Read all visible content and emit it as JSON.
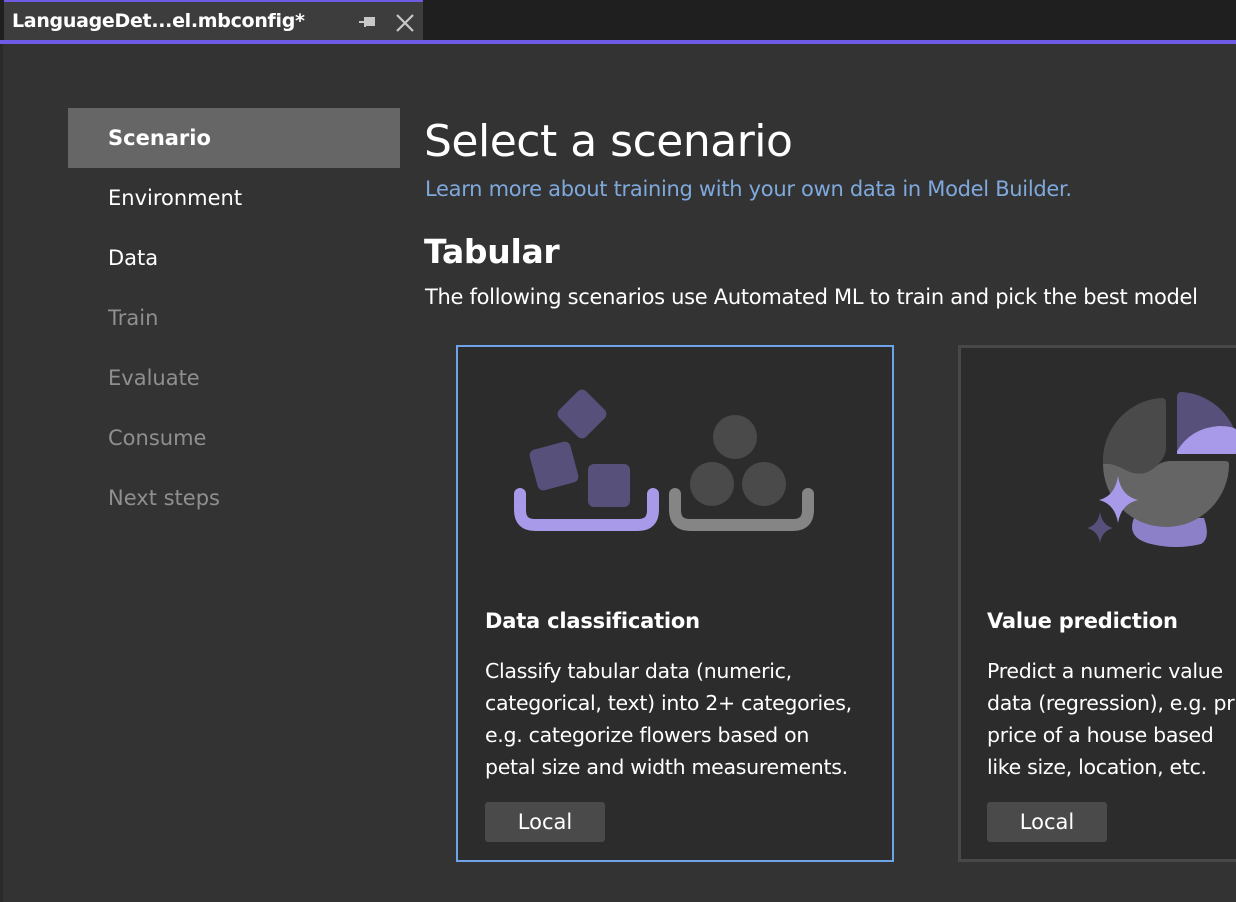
{
  "tab": {
    "title": "LanguageDet...el.mbconfig*",
    "pin_icon": "pin-icon",
    "close_icon": "close-icon"
  },
  "colors": {
    "accent": "#6e5ce6",
    "link": "#7fa9dd",
    "selected_card_border": "#6fa3e8",
    "nav_selected_bg": "#666666",
    "illustration_purple_light": "#a89ae8",
    "illustration_purple_dark": "#57507a",
    "illustration_gray": "#4a4a4a"
  },
  "nav": {
    "items": [
      {
        "label": "Scenario",
        "state": "selected"
      },
      {
        "label": "Environment",
        "state": "enabled"
      },
      {
        "label": "Data",
        "state": "enabled"
      },
      {
        "label": "Train",
        "state": "disabled"
      },
      {
        "label": "Evaluate",
        "state": "disabled"
      },
      {
        "label": "Consume",
        "state": "disabled"
      },
      {
        "label": "Next steps",
        "state": "disabled"
      }
    ]
  },
  "main": {
    "title": "Select a scenario",
    "learn_link": "Learn more about training with your own data in Model Builder.",
    "section": {
      "title": "Tabular",
      "description": "The following scenarios use Automated ML to train and pick the best model"
    },
    "cards": [
      {
        "title": "Data classification",
        "description_lines": [
          "Classify tabular data (numeric,",
          "categorical, text) into 2+ categories,",
          "e.g. categorize flowers based on",
          "petal size and width measurements."
        ],
        "button": "Local",
        "selected": true,
        "icon": "classification-illustration-icon"
      },
      {
        "title": "Value prediction",
        "description_lines": [
          "Predict a numeric value",
          "data (regression), e.g. pr",
          "price of a house based",
          "like size, location, etc."
        ],
        "button": "Local",
        "selected": false,
        "icon": "prediction-illustration-icon"
      }
    ]
  }
}
